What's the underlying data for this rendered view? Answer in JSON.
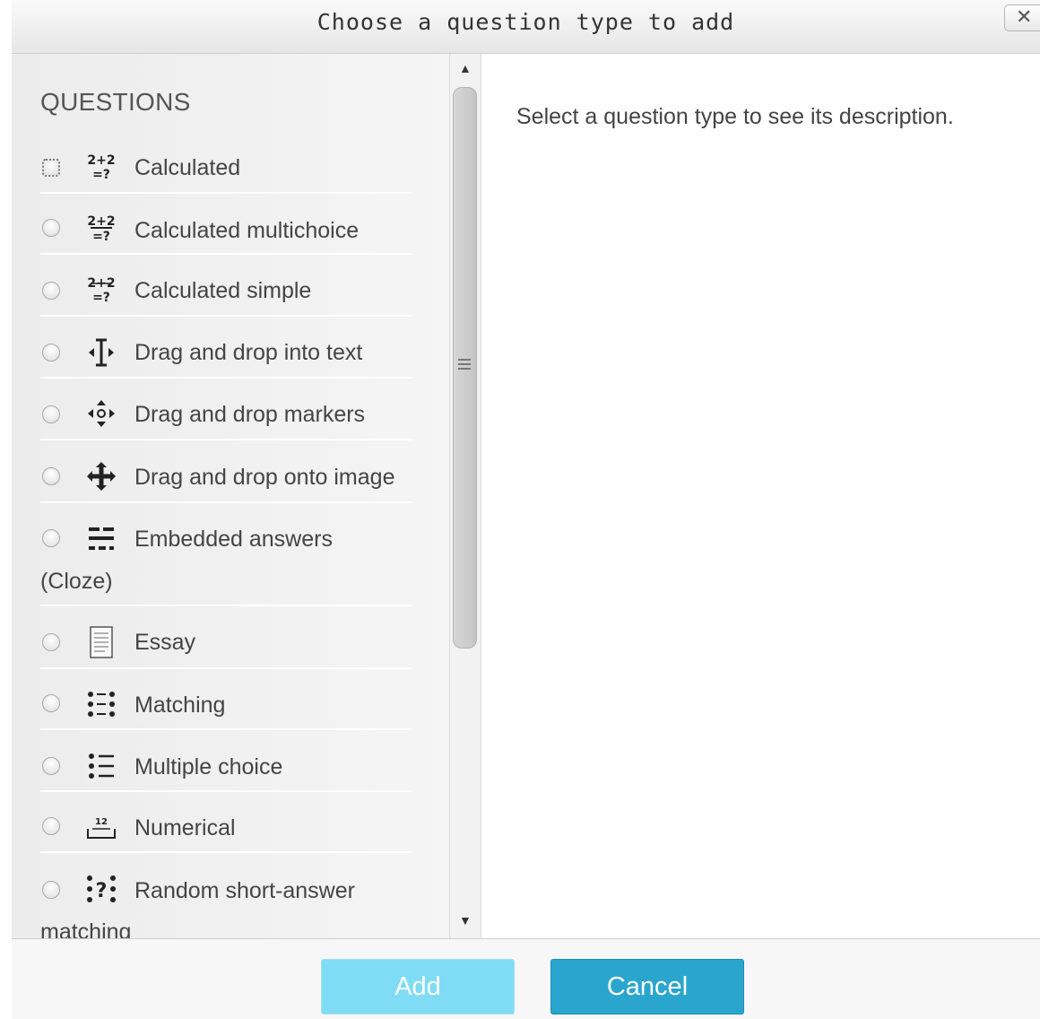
{
  "dialog": {
    "title": "Choose a question type to add",
    "close_label": "✕"
  },
  "questions": {
    "heading": "QUESTIONS",
    "items": [
      {
        "label": "Calculated",
        "icon": "calculated-icon"
      },
      {
        "label": "Calculated multichoice",
        "icon": "calculated-multichoice-icon"
      },
      {
        "label": "Calculated simple",
        "icon": "calculated-simple-icon"
      },
      {
        "label": "Drag and drop into text",
        "icon": "drag-drop-text-icon"
      },
      {
        "label": "Drag and drop markers",
        "icon": "drag-drop-markers-icon"
      },
      {
        "label": "Drag and drop onto image",
        "icon": "drag-drop-image-icon"
      },
      {
        "label": "Embedded answers",
        "label2": "(Cloze)",
        "icon": "embedded-answers-icon"
      },
      {
        "label": "Essay",
        "icon": "essay-icon"
      },
      {
        "label": "Matching",
        "icon": "matching-icon"
      },
      {
        "label": "Multiple choice",
        "icon": "multiple-choice-icon"
      },
      {
        "label": "Numerical",
        "icon": "numerical-icon"
      },
      {
        "label": "Random short-answer",
        "label2": "matching",
        "icon": "random-short-answer-icon"
      }
    ]
  },
  "description": {
    "placeholder": "Select a question type to see its description."
  },
  "footer": {
    "add_label": "Add",
    "cancel_label": "Cancel"
  },
  "colors": {
    "add_button": "#7fdcf4",
    "cancel_button": "#2aa6ce"
  }
}
